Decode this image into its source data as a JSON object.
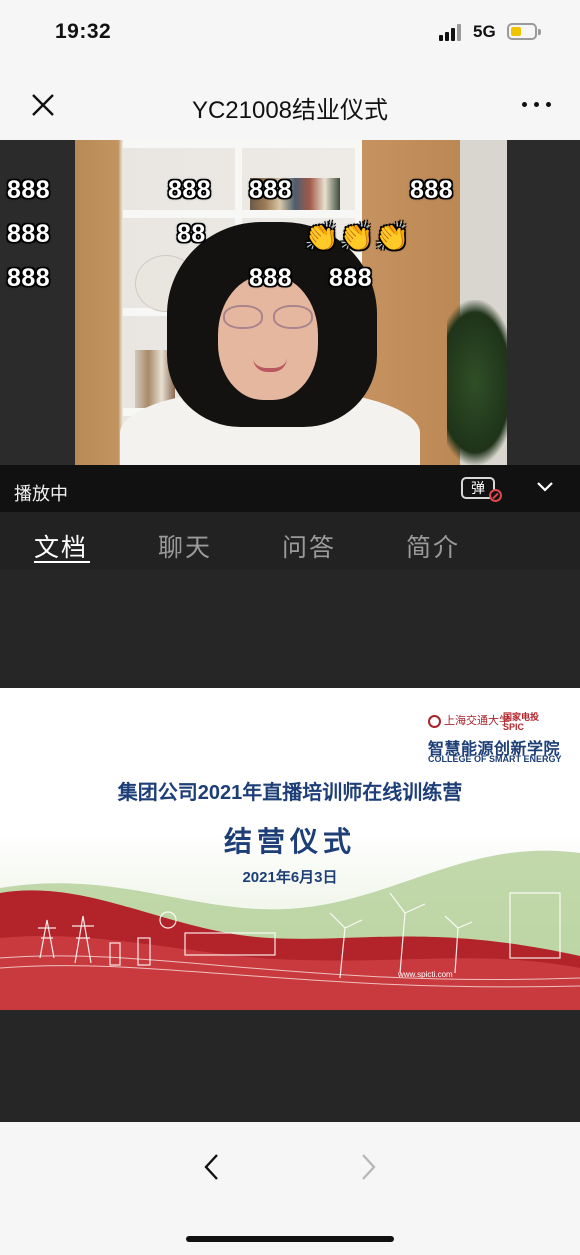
{
  "status_bar": {
    "time": "19:32",
    "network": "5G",
    "battery_level": 0.45,
    "battery_color": "#f2c300",
    "signal_icon": "cellular-signal-icon"
  },
  "nav": {
    "title": "YC21008结业仪式",
    "close_icon": "close-icon",
    "more_icon": "more-options-icon"
  },
  "video": {
    "status_text": "播放中",
    "danmaku_toggle_label": "弹",
    "danmaku": [
      {
        "text": "888"
      },
      {
        "text": "888"
      },
      {
        "text": "888"
      },
      {
        "text": "888"
      },
      {
        "text": "888"
      },
      {
        "text": "88"
      },
      {
        "text": "👏👏👏"
      },
      {
        "text": "888"
      },
      {
        "text": "888"
      },
      {
        "text": "888"
      }
    ]
  },
  "tabs": [
    {
      "label": "文档",
      "active": true
    },
    {
      "label": "聊天",
      "active": false
    },
    {
      "label": "问答",
      "active": false
    },
    {
      "label": "简介",
      "active": false
    }
  ],
  "slide": {
    "logo_sjtu": "上海交通大学",
    "logo_spic": "国家电投",
    "logo_spic_en": "SPIC",
    "college_cn": "智慧能源创新学院",
    "college_en": "COLLEGE OF SMART ENERGY",
    "title": "集团公司2021年直播培训师在线训练营",
    "subtitle": "结营仪式",
    "date": "2021年6月3日",
    "url": "www.spicti.com",
    "colors": {
      "primary": "#1d3e77",
      "red": "#a8232a",
      "green": "#7fae4c"
    }
  },
  "toolbar": {
    "back_icon": "chevron-left-icon",
    "forward_icon": "chevron-right-icon"
  }
}
